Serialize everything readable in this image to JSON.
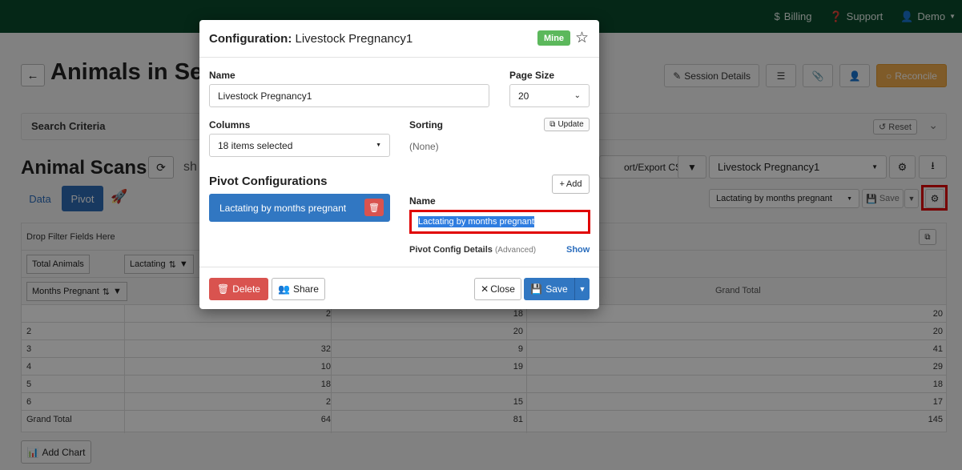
{
  "topnav": {
    "billing": "Billing",
    "support": "Support",
    "user": "Demo"
  },
  "page": {
    "title": "Animals in Ses",
    "header_buttons": {
      "session_details": "Session Details",
      "reconcile": "Reconcile"
    },
    "search_criteria": {
      "label": "Search Criteria",
      "reset": "Reset"
    },
    "scans": {
      "title": "Animal Scans",
      "show_text": "sh",
      "export_label": "ort/Export CSV",
      "config_select": "Livestock Pregnancy1",
      "tabs": {
        "data": "Data",
        "pivot": "Pivot"
      }
    },
    "pivot_toolbar": {
      "selected": "Lactating by months pregnant",
      "save": "Save"
    },
    "pivot_table": {
      "drop_text": "Drop Filter Fields Here",
      "aggregator": "Total Animals",
      "col_field": "Lactating",
      "row_field": "Months Pregnant",
      "grand_total_header": "Grand Total",
      "rows": [
        {
          "label": "",
          "c1": "2",
          "c2": "18",
          "total": "20"
        },
        {
          "label": "2",
          "c1": "",
          "c2": "20",
          "total": "20"
        },
        {
          "label": "3",
          "c1": "32",
          "c2": "9",
          "total": "41"
        },
        {
          "label": "4",
          "c1": "10",
          "c2": "19",
          "total": "29"
        },
        {
          "label": "5",
          "c1": "18",
          "c2": "",
          "total": "18"
        },
        {
          "label": "6",
          "c1": "2",
          "c2": "15",
          "total": "17"
        },
        {
          "label": "Grand Total",
          "c1": "64",
          "c2": "81",
          "total": "145"
        }
      ]
    },
    "add_chart": "Add Chart"
  },
  "modal": {
    "title_prefix": "Configuration:",
    "title_name": "Livestock Pregnancy1",
    "badge": "Mine",
    "name_label": "Name",
    "name_value": "Livestock Pregnancy1",
    "page_size_label": "Page Size",
    "page_size_value": "20",
    "columns_label": "Columns",
    "columns_value": "18 items selected",
    "sorting_label": "Sorting",
    "update_btn": "Update",
    "sorting_value": "(None)",
    "pivot_configs_title": "Pivot Configurations",
    "add_btn": "Add",
    "pivot_items": [
      "Lactating by months pregnant"
    ],
    "pivot_name_label": "Name",
    "pivot_name_value": "Lactating by months pregnant",
    "details_label": "Pivot Config Details",
    "details_advanced": "(Advanced)",
    "show_link": "Show",
    "delete_btn": "Delete",
    "share_btn": "Share",
    "close_btn": "Close",
    "save_btn": "Save"
  },
  "colors": {
    "topbar": "#0b4a2c",
    "primary": "#3177c2",
    "danger": "#d9534f",
    "success": "#5cb85c",
    "warning": "#f0ad4e",
    "highlight": "#e00000"
  }
}
